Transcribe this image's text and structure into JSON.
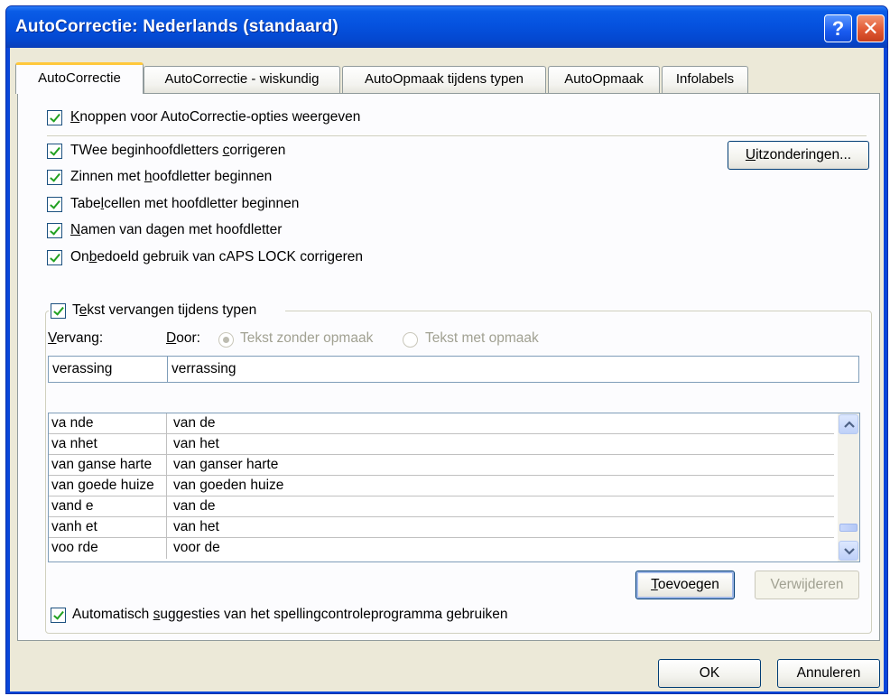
{
  "window": {
    "title": "AutoCorrectie: Nederlands (standaard)",
    "help_label": "?",
    "close_label": "✕"
  },
  "tabs": [
    {
      "label": "AutoCorrectie",
      "active": true
    },
    {
      "label": "AutoCorrectie - wiskundig",
      "active": false
    },
    {
      "label": "AutoOpmaak tijdens typen",
      "active": false
    },
    {
      "label": "AutoOpmaak",
      "active": false
    },
    {
      "label": "Infolabels",
      "active": false
    }
  ],
  "options": {
    "show_buttons": {
      "pre": "",
      "key": "K",
      "post": "noppen voor AutoCorrectie-opties weergeven",
      "checked": true
    },
    "two_initial_caps": {
      "pre": "TWee beginhoofdletters ",
      "key": "c",
      "post": "orrigeren",
      "checked": true
    },
    "sentence_caps": {
      "pre": "Zinnen met ",
      "key": "h",
      "post": "oofdletter beginnen",
      "checked": true
    },
    "table_cell_caps": {
      "pre": "Tabe",
      "key": "l",
      "post": "cellen met hoofdletter beginnen",
      "checked": true
    },
    "day_names": {
      "pre": "",
      "key": "N",
      "post": "amen van dagen met hoofdletter",
      "checked": true
    },
    "caps_lock": {
      "pre": "On",
      "key": "b",
      "post": "edoeld gebruik van cAPS LOCK corrigeren",
      "checked": true
    }
  },
  "exceptions_button": {
    "key": "U",
    "post": "itzonderingen..."
  },
  "replace_group": {
    "toggle": {
      "pre": "T",
      "key": "e",
      "post": "kst vervangen tijdens typen",
      "checked": true
    },
    "replace_label": {
      "key": "V",
      "post": "ervang:"
    },
    "with_label": {
      "key": "D",
      "post": "oor:"
    },
    "radio_plain": {
      "label": "Tekst zonder opmaak",
      "selected": true
    },
    "radio_formatted": {
      "label": "Tekst met opmaak",
      "selected": false
    },
    "replace_value": "verassing",
    "with_value": "verrassing"
  },
  "list": {
    "rows": [
      {
        "replace": "va nde",
        "with": "van de"
      },
      {
        "replace": "va nhet",
        "with": "van het"
      },
      {
        "replace": "van ganse harte",
        "with": "van ganser harte"
      },
      {
        "replace": "van goede huize",
        "with": "van goeden huize"
      },
      {
        "replace": "vand e",
        "with": "van de"
      },
      {
        "replace": "vanh et",
        "with": "van het"
      },
      {
        "replace": "voo rde",
        "with": "voor de"
      }
    ]
  },
  "add_button": {
    "key": "T",
    "post": "oevoegen"
  },
  "delete_button": {
    "label": "Verwijderen"
  },
  "spelling_suggestions": {
    "pre": "Automatisch ",
    "key": "s",
    "post": "uggesties van het spellingcontroleprogramma gebruiken",
    "checked": true
  },
  "ok_button": {
    "label": "OK"
  },
  "cancel_button": {
    "label": "Annuleren"
  }
}
